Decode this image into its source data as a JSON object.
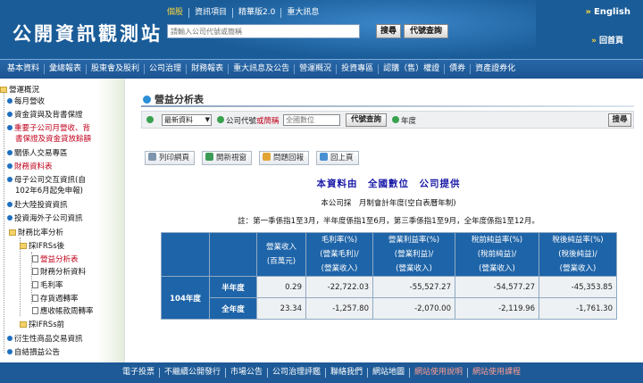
{
  "header": {
    "logo": "公開資訊觀測站",
    "top_links": [
      "個股",
      "資訊項目",
      "精華版2.0",
      "重大訊息"
    ],
    "search_placeholder": "請輸入公司代號或簡稱",
    "search_button": "搜尋",
    "code_lookup_button": "代號查詢",
    "lang_link": "English",
    "home_link": "回首頁"
  },
  "nav": {
    "items": [
      "基本資料",
      "彙總報表",
      "股東會及股利",
      "公司治理",
      "財務報表",
      "重大訊息及公告",
      "營運概況",
      "投資專區",
      "認購（售）權證",
      "債券",
      "資產證券化"
    ]
  },
  "sidebar": {
    "items": [
      {
        "label": "營運概況"
      },
      {
        "label": "每月營收"
      },
      {
        "label": "資金貸與及背書保證"
      },
      {
        "label": "重要子公司月營收、背"
      },
      {
        "label": "書保證及資金貸放餘額"
      },
      {
        "label": "關係人交易專區"
      },
      {
        "label": "財務資料表"
      },
      {
        "label": "母子公司交互資訊(自"
      },
      {
        "label": "102年6月起免申報)"
      },
      {
        "label": "赴大陸投資資訊"
      },
      {
        "label": "投資海外子公司資訊"
      },
      {
        "label": "財務比率分析"
      },
      {
        "label": "採IFRSs後"
      },
      {
        "label": "營益分析表"
      },
      {
        "label": "財務分析資料"
      },
      {
        "label": "毛利率"
      },
      {
        "label": "存貨週轉率"
      },
      {
        "label": "應收帳款周轉率"
      },
      {
        "label": "採IFRSs前"
      },
      {
        "label": "衍生性商品交易資訊"
      },
      {
        "label": "自結損益公告"
      }
    ]
  },
  "main": {
    "page_title": "營益分析表",
    "filter": {
      "select_value": "最新資料",
      "code_label_a": "公司代號",
      "code_label_b": "或簡稱",
      "code_input_placeholder": "全國數位",
      "code_lookup_button": "代號查詢",
      "year_label": "年度",
      "search_button": "搜尋"
    },
    "toolbar": [
      "列印網頁",
      "開新視窗",
      "問題回報",
      "回上頁"
    ],
    "source_line": "本資料由　全國數位　公司提供",
    "desc_line": "本公司採　月制會計年度(空白表曆年制)",
    "note_line": "註：第一季係指1至3月，半年度係指1至6月，第三季係指1至9月，全年度係指1至12月。",
    "table": {
      "headers": [
        [
          "營業收入",
          "(百萬元)"
        ],
        [
          "毛利率(%)",
          "(營業毛利)/",
          "(營業收入)"
        ],
        [
          "營業利益率(%)",
          "(營業利益)/",
          "(營業收入)"
        ],
        [
          "稅前純益率(%)",
          "(稅前純益)/",
          "(營業收入)"
        ],
        [
          "稅後純益率(%)",
          "(稅後純益)/",
          "(營業收入)"
        ]
      ],
      "year_label": "104年度",
      "rows": [
        {
          "period": "半年度",
          "values": [
            "0.29",
            "-22,722.03",
            "-55,527.27",
            "-54,577.27",
            "-45,353.85"
          ]
        },
        {
          "period": "全年度",
          "values": [
            "23.34",
            "-1,257.80",
            "-2,070.00",
            "-2,119.96",
            "-1,761.30"
          ]
        }
      ]
    }
  },
  "footer": {
    "items": [
      "電子投票",
      "不繼續公開發行",
      "市場公告",
      "公司治理評鑑",
      "聯絡我們",
      "網站地圖",
      "網站使用說明",
      "網站使用課程"
    ]
  },
  "colors": {
    "header_blue": "#1a5c98",
    "table_header_blue": "#1e64a8",
    "accent_yellow": "#ffd83a",
    "link_red": "#c0001b"
  }
}
